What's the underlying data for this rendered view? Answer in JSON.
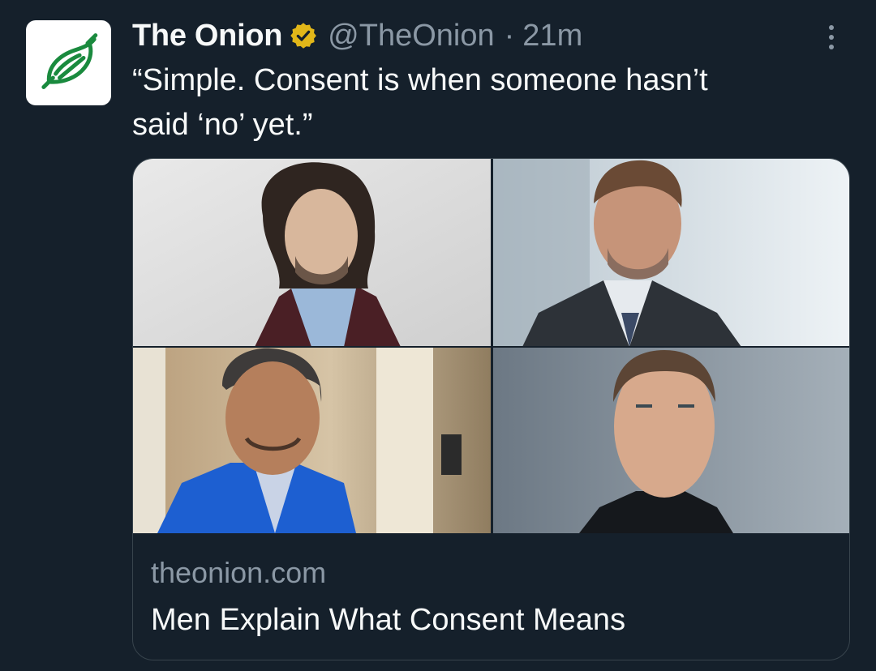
{
  "tweet": {
    "author": {
      "display_name": "The Onion",
      "handle": "@TheOnion",
      "verified_badge": "gold-verified-icon",
      "avatar": "onion-logo-icon"
    },
    "separator": "·",
    "timestamp": "21m",
    "more_icon": "more-vertical-icon",
    "text_line1": "“Simple. Consent is when someone hasn’t",
    "text_line2": "said ‘no’ yet.”",
    "card": {
      "domain": "theonion.com",
      "title": "Men Explain What Consent Means",
      "image_description_icon": "four-portrait-grid"
    }
  },
  "colors": {
    "background": "#15202b",
    "text_primary": "#f7f9f9",
    "text_secondary": "#8b98a5",
    "border": "#38444d",
    "verified_gold": "#e2b719",
    "onion_green": "#1a8a3e"
  }
}
